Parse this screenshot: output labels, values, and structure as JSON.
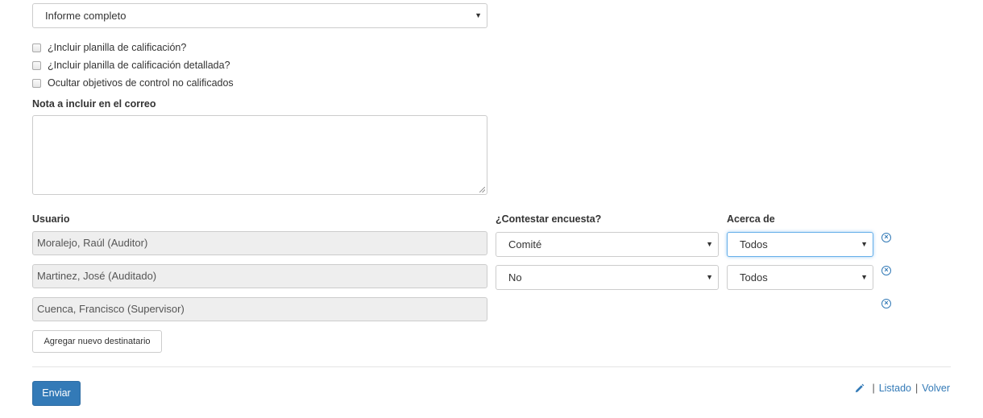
{
  "report_type": {
    "selected": "Informe completo"
  },
  "checkboxes": [
    {
      "label": "¿Incluir planilla de calificación?",
      "checked": false
    },
    {
      "label": "¿Incluir planilla de calificación detallada?",
      "checked": false
    },
    {
      "label": "Ocultar objetivos de control no calificados",
      "checked": false
    }
  ],
  "note": {
    "label": "Nota a incluir en el correo",
    "value": ""
  },
  "recipients_table": {
    "headers": {
      "user": "Usuario",
      "survey": "¿Contestar encuesta?",
      "about": "Acerca de"
    },
    "rows": [
      {
        "user": "Moralejo, Raúl (Auditor)",
        "survey": "Comité",
        "about": "Todos"
      },
      {
        "user": "Martinez, José (Auditado)",
        "survey": "No",
        "about": "Todos"
      },
      {
        "user": "Cuenca, Francisco (Supervisor)"
      }
    ]
  },
  "add_recipient_label": "Agregar nuevo destinatario",
  "submit_label": "Enviar",
  "footer_links": {
    "list": "Listado",
    "back": "Volver",
    "separator": "|"
  },
  "icons": {
    "remove": "remove-circle-icon",
    "edit": "pencil-icon",
    "dropdown": "caret-down-icon"
  },
  "colors": {
    "primary": "#337ab7",
    "readonly_bg": "#eeeeee",
    "border": "#cccccc"
  }
}
